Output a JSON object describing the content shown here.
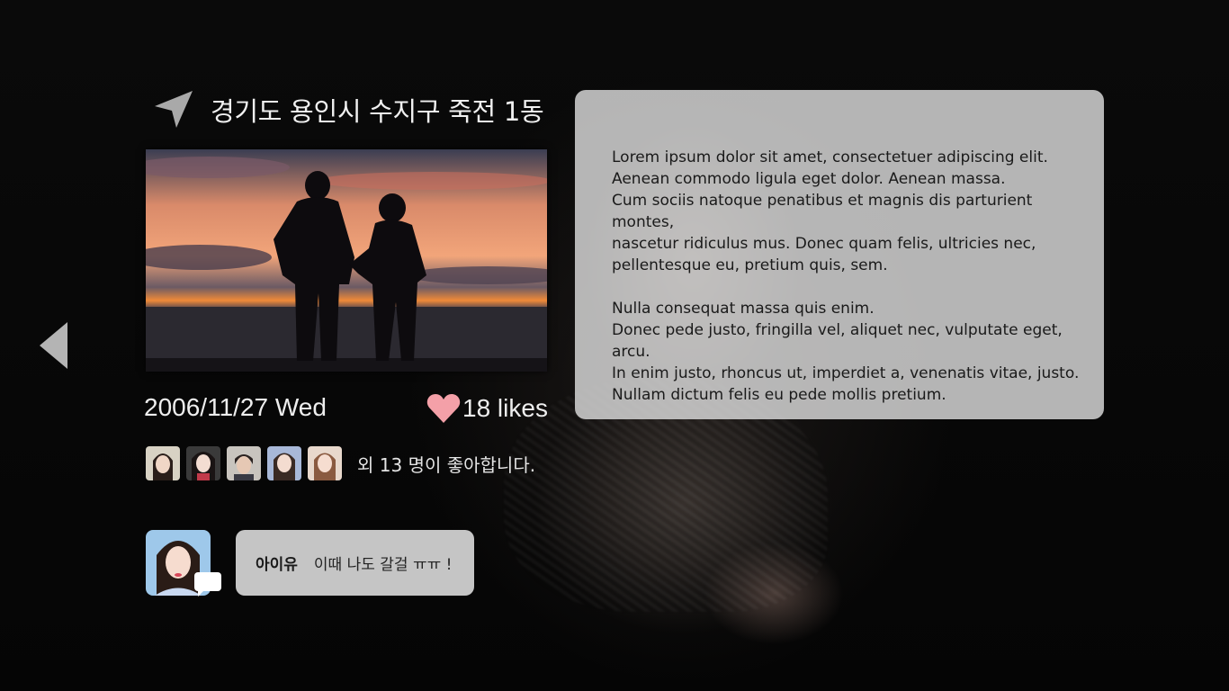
{
  "location": {
    "icon": "navigation-arrow-icon",
    "text": "경기도 용인시 수지구 죽전 1동"
  },
  "post": {
    "date": "2006/11/27  Wed",
    "likes_label": "18 likes",
    "likes_icon": "heart-icon",
    "likers_text": "외 13 명이 좋아합니다."
  },
  "comment": {
    "author": "아이유",
    "message": "이때 나도 갈걸 ㅠㅠ !"
  },
  "description": {
    "paragraph1": "Lorem ipsum dolor sit amet, consectetuer adipiscing elit.\nAenean commodo ligula eget dolor. Aenean massa.\nCum sociis natoque penatibus et magnis dis parturient montes,\nnascetur ridiculus mus. Donec quam felis, ultricies nec,\npellentesque eu, pretium quis, sem.",
    "paragraph2": "Nulla consequat massa quis enim.\nDonec pede justo, fringilla vel, aliquet nec, vulputate eget, arcu.\nIn enim justo, rhoncus ut, imperdiet a, venenatis vitae, justo.\nNullam dictum felis eu pede mollis pretium."
  },
  "colors": {
    "heart": "#f4a0a8",
    "panel": "#dcdcdc",
    "comment_box": "#c5c5c5"
  }
}
